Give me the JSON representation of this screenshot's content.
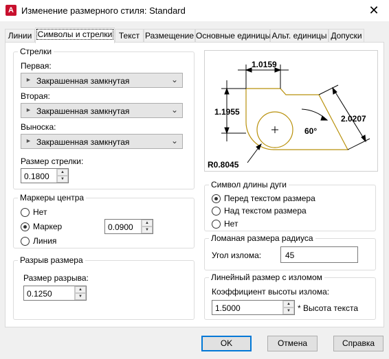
{
  "window": {
    "title": "Изменение размерного стиля: Standard",
    "icon": "A",
    "close_glyph": "✕"
  },
  "tabs": [
    "Линии",
    "Символы и стрелки",
    "Текст",
    "Размещение",
    "Основные единицы",
    "Альт. единицы",
    "Допуски"
  ],
  "active_tab": "Символы и стрелки",
  "arrows": {
    "group_title": "Стрелки",
    "first_label": "Первая:",
    "first_value": "Закрашенная замкнутая",
    "second_label": "Вторая:",
    "second_value": "Закрашенная замкнутая",
    "leader_label": "Выноска:",
    "leader_value": "Закрашенная замкнутая",
    "size_label": "Размер стрелки:",
    "size_value": "0.1800"
  },
  "center_marks": {
    "group_title": "Маркеры центра",
    "options": [
      "Нет",
      "Маркер",
      "Линия"
    ],
    "selected": "Маркер",
    "size_value": "0.0900"
  },
  "dim_break": {
    "group_title": "Разрыв размера",
    "size_label": "Размер разрыва:",
    "size_value": "0.1250"
  },
  "preview": {
    "dim_top": "1.0159",
    "dim_left": "1.1955",
    "dim_right": "2.0207",
    "angle": "60°",
    "radius": "R0.8045"
  },
  "arc_length": {
    "group_title": "Символ длины дуги",
    "options": [
      "Перед текстом размера",
      "Над текстом размера",
      "Нет"
    ],
    "selected": "Перед текстом размера"
  },
  "radius_jog": {
    "group_title": "Ломаная размера радиуса",
    "angle_label": "Угол излома:",
    "angle_value": "45"
  },
  "linear_jog": {
    "group_title": "Линейный размер с изломом",
    "factor_label": "Коэффициент высоты излома:",
    "factor_value": "1.5000",
    "suffix": "* Высота текста"
  },
  "buttons": {
    "ok": "OK",
    "cancel": "Отмена",
    "help": "Справка"
  },
  "colors": {
    "accent": "#0078d7",
    "app_icon": "#c8102e",
    "preview_outline": "#b8900a"
  }
}
